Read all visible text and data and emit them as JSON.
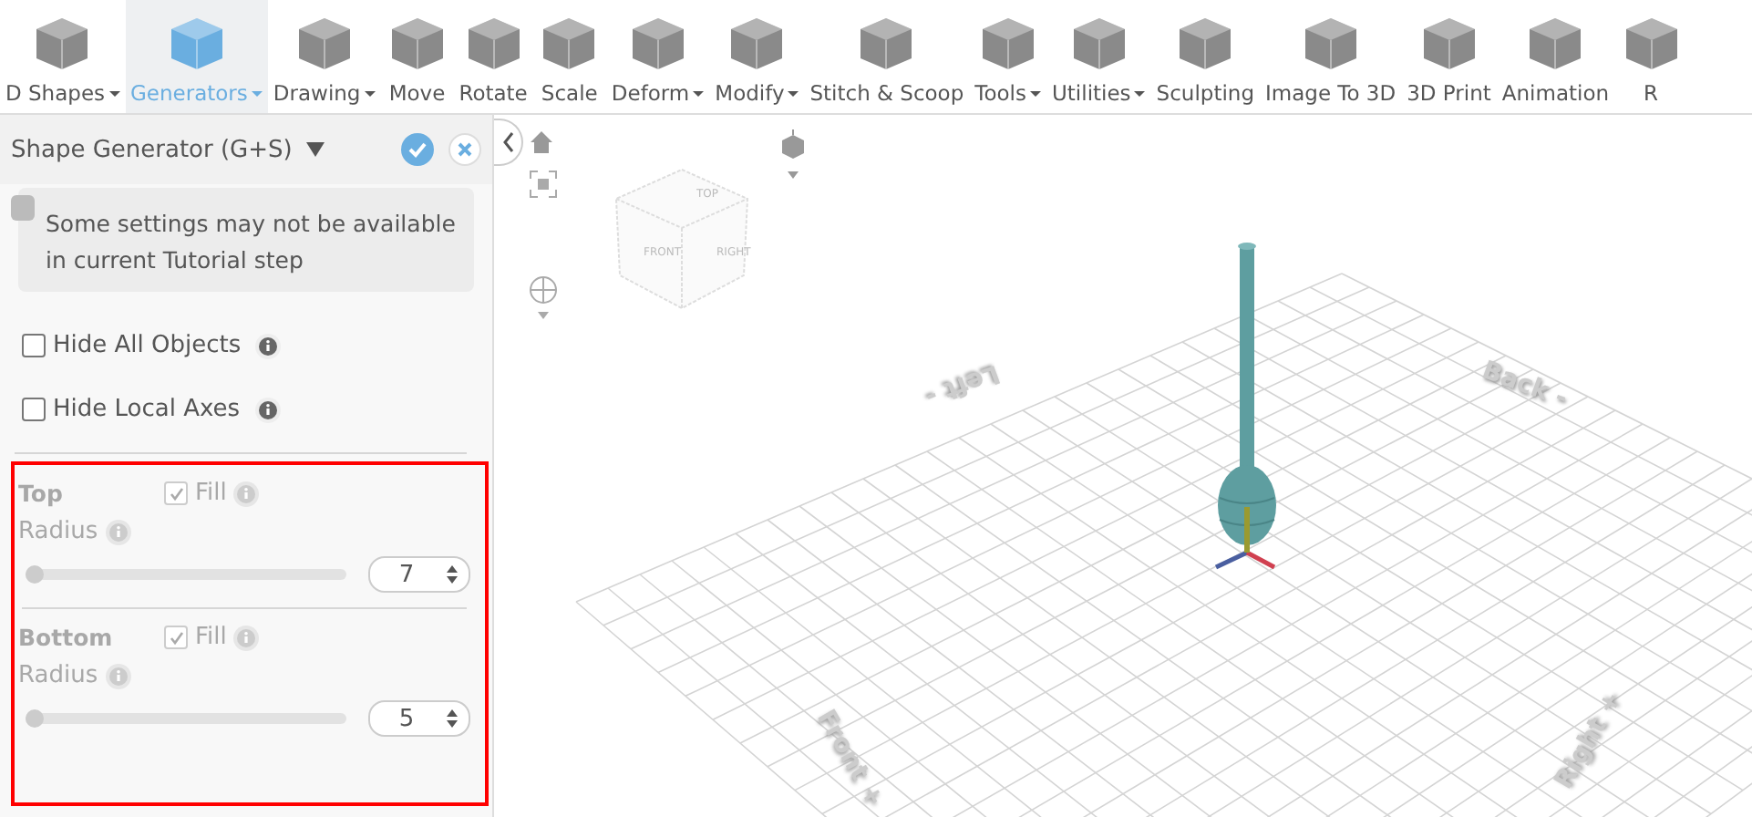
{
  "toolbar": [
    {
      "label": "D Shapes",
      "menu": true,
      "selected": false
    },
    {
      "label": "Generators",
      "menu": true,
      "selected": true
    },
    {
      "label": "Drawing",
      "menu": true,
      "selected": false
    },
    {
      "label": "Move",
      "menu": false,
      "selected": false
    },
    {
      "label": "Rotate",
      "menu": false,
      "selected": false
    },
    {
      "label": "Scale",
      "menu": false,
      "selected": false
    },
    {
      "label": "Deform",
      "menu": true,
      "selected": false
    },
    {
      "label": "Modify",
      "menu": true,
      "selected": false
    },
    {
      "label": "Stitch & Scoop",
      "menu": false,
      "selected": false
    },
    {
      "label": "Tools",
      "menu": true,
      "selected": false
    },
    {
      "label": "Utilities",
      "menu": true,
      "selected": false
    },
    {
      "label": "Sculpting",
      "menu": false,
      "selected": false
    },
    {
      "label": "Image To 3D",
      "menu": false,
      "selected": false
    },
    {
      "label": "3D Print",
      "menu": false,
      "selected": false
    },
    {
      "label": "Animation",
      "menu": false,
      "selected": false
    },
    {
      "label": "R",
      "menu": false,
      "selected": false
    }
  ],
  "panel": {
    "title": "Shape Generator (G+S)",
    "notice": "Some settings may not be available in current Tutorial step",
    "options": [
      {
        "label": "Hide All Objects",
        "checked": false
      },
      {
        "label": "Hide Local Axes",
        "checked": false
      }
    ],
    "sections": [
      {
        "title": "Top",
        "fill_label": "Fill",
        "fill": true,
        "disabled": true,
        "radius_label": "Radius",
        "level": 0,
        "value": "7"
      },
      {
        "title": "Bottom",
        "fill_label": "Fill",
        "fill": true,
        "disabled": true,
        "radius_label": "Radius",
        "level": 0,
        "value": "5"
      }
    ]
  },
  "viewport": {
    "cube_faces": [
      "TOP",
      "FRONT",
      "RIGHT"
    ],
    "axis_labels": [
      "Left -",
      "Back -",
      "Front +",
      "Right +"
    ]
  }
}
